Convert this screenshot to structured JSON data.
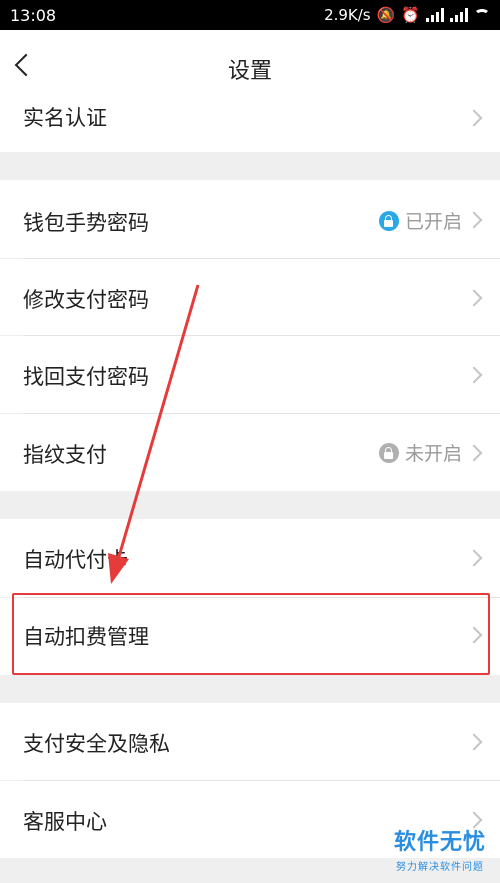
{
  "statusbar": {
    "time": "13:08",
    "net_speed": "2.9K/s",
    "battery_icon": "battery-icon"
  },
  "navbar": {
    "title": "设置"
  },
  "rows": {
    "realname": {
      "label": "实名认证"
    },
    "gesture": {
      "label": "钱包手势密码",
      "status": "已开启",
      "status_color": "#2aa8e6"
    },
    "change_pw": {
      "label": "修改支付密码"
    },
    "recover_pw": {
      "label": "找回支付密码"
    },
    "fingerprint": {
      "label": "指纹支付",
      "status": "未开启",
      "status_color": "#b0b0b0"
    },
    "auto_card": {
      "label": "自动代付卡"
    },
    "auto_deduct": {
      "label": "自动扣费管理"
    },
    "security": {
      "label": "支付安全及隐私"
    },
    "service": {
      "label": "客服中心"
    }
  },
  "watermark": {
    "main": "软件无忧",
    "sub": "努力解决软件问题"
  },
  "colors": {
    "highlight": "#e53b3b",
    "arrow": "#e53b3b"
  }
}
